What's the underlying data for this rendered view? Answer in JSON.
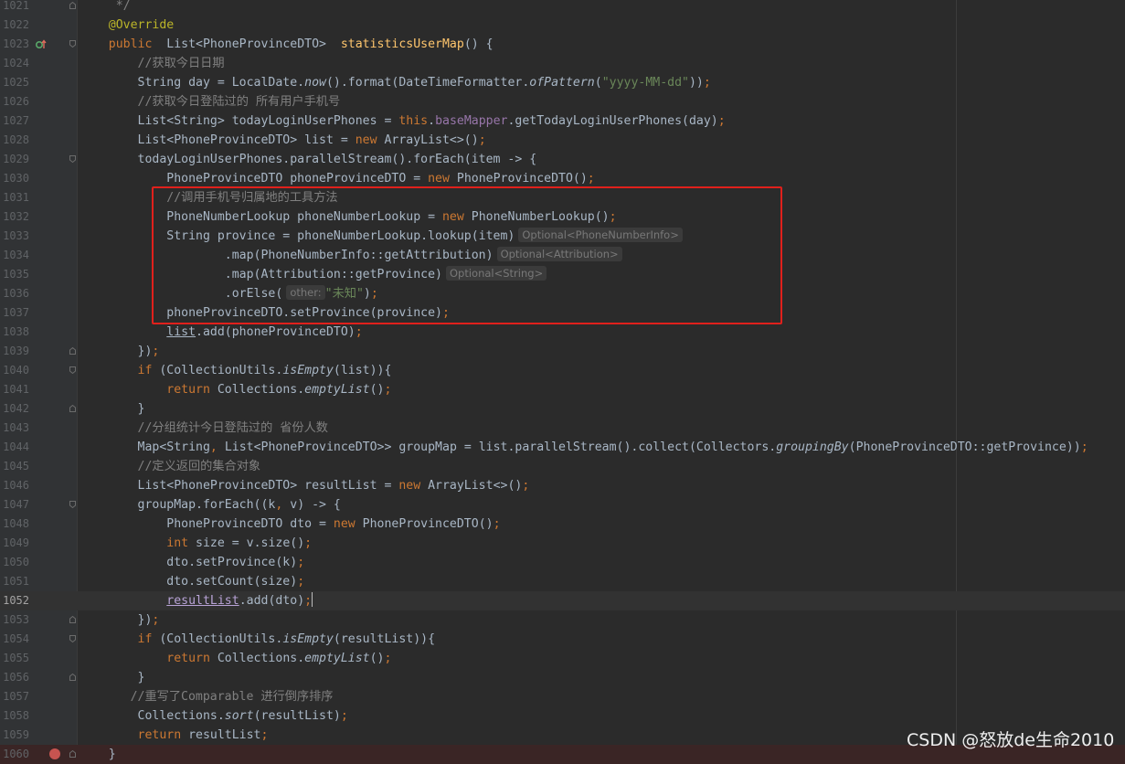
{
  "editor": {
    "language": "java",
    "lines": [
      {
        "no": "1021",
        "tokens": [
          [
            "c",
            "     */"
          ]
        ]
      },
      {
        "no": "1022",
        "tokens": [
          [
            "a",
            "    @Override"
          ]
        ]
      },
      {
        "no": "1023",
        "tokens": [
          [
            "k",
            "    public  "
          ],
          [
            "p",
            "List<PhoneProvinceDTO>  "
          ],
          [
            "m",
            "statisticsUserMap"
          ],
          [
            "p",
            "() {"
          ]
        ]
      },
      {
        "no": "1024",
        "tokens": [
          [
            "c",
            "        //获取今日日期"
          ]
        ]
      },
      {
        "no": "1025",
        "tokens": [
          [
            "p",
            "        String day = LocalDate."
          ],
          [
            "pi",
            "now"
          ],
          [
            "p",
            "().format(DateTimeFormatter."
          ],
          [
            "pi",
            "ofPattern"
          ],
          [
            "p",
            "("
          ],
          [
            "s",
            "\"yyyy-MM-dd\""
          ],
          [
            "p",
            "))"
          ],
          [
            "k",
            ";"
          ]
        ]
      },
      {
        "no": "1026",
        "tokens": [
          [
            "c",
            "        //获取今日登陆过的 所有用户手机号"
          ]
        ]
      },
      {
        "no": "1027",
        "tokens": [
          [
            "p",
            "        List<String> todayLoginUserPhones = "
          ],
          [
            "k",
            "this"
          ],
          [
            "p",
            "."
          ],
          [
            "f",
            "baseMapper"
          ],
          [
            "p",
            ".getTodayLoginUserPhones(day)"
          ],
          [
            "k",
            ";"
          ]
        ]
      },
      {
        "no": "1028",
        "tokens": [
          [
            "p",
            "        List<PhoneProvinceDTO> list = "
          ],
          [
            "k",
            "new "
          ],
          [
            "p",
            "ArrayList<>()"
          ],
          [
            "k",
            ";"
          ]
        ]
      },
      {
        "no": "1029",
        "tokens": [
          [
            "p",
            "        todayLoginUserPhones.parallelStream().forEach(item -> {"
          ]
        ]
      },
      {
        "no": "1030",
        "tokens": [
          [
            "p",
            "            PhoneProvinceDTO phoneProvinceDTO = "
          ],
          [
            "k",
            "new "
          ],
          [
            "p",
            "PhoneProvinceDTO()"
          ],
          [
            "k",
            ";"
          ]
        ]
      },
      {
        "no": "1031",
        "tokens": [
          [
            "c",
            "            //调用手机号归属地的工具方法"
          ]
        ]
      },
      {
        "no": "1032",
        "tokens": [
          [
            "p",
            "            PhoneNumberLookup phoneNumberLookup = "
          ],
          [
            "k",
            "new "
          ],
          [
            "p",
            "PhoneNumberLookup()"
          ],
          [
            "k",
            ";"
          ]
        ]
      },
      {
        "no": "1033",
        "tokens": [
          [
            "p",
            "            String province = phoneNumberLookup.lookup(item)"
          ],
          [
            "h",
            "Optional<PhoneNumberInfo>"
          ]
        ]
      },
      {
        "no": "1034",
        "tokens": [
          [
            "p",
            "                    .map(PhoneNumberInfo::getAttribution)"
          ],
          [
            "h",
            "Optional<Attribution>"
          ]
        ]
      },
      {
        "no": "1035",
        "tokens": [
          [
            "p",
            "                    .map(Attribution::getProvince)"
          ],
          [
            "h",
            "Optional<String>"
          ]
        ]
      },
      {
        "no": "1036",
        "tokens": [
          [
            "p",
            "                    .orElse("
          ],
          [
            "h",
            "other:"
          ],
          [
            "s",
            "\"未知\""
          ],
          [
            "p",
            ")"
          ],
          [
            "k",
            ";"
          ]
        ]
      },
      {
        "no": "1037",
        "tokens": [
          [
            "p",
            "            phoneProvinceDTO.setProvince(province)"
          ],
          [
            "k",
            ";"
          ]
        ]
      },
      {
        "no": "1038",
        "tokens": [
          [
            "p",
            "            "
          ],
          [
            "pu",
            "list"
          ],
          [
            "p",
            ".add(phoneProvinceDTO)"
          ],
          [
            "k",
            ";"
          ]
        ]
      },
      {
        "no": "1039",
        "tokens": [
          [
            "p",
            "        })"
          ],
          [
            "k",
            ";"
          ]
        ]
      },
      {
        "no": "1040",
        "tokens": [
          [
            "k",
            "        if "
          ],
          [
            "p",
            "(CollectionUtils."
          ],
          [
            "pi",
            "isEmpty"
          ],
          [
            "p",
            "(list)){"
          ]
        ]
      },
      {
        "no": "1041",
        "tokens": [
          [
            "k",
            "            return "
          ],
          [
            "p",
            "Collections."
          ],
          [
            "pi",
            "emptyList"
          ],
          [
            "p",
            "()"
          ],
          [
            "k",
            ";"
          ]
        ]
      },
      {
        "no": "1042",
        "tokens": [
          [
            "p",
            "        }"
          ]
        ]
      },
      {
        "no": "1043",
        "tokens": [
          [
            "c",
            "        //分组统计今日登陆过的 省份人数"
          ]
        ]
      },
      {
        "no": "1044",
        "tokens": [
          [
            "p",
            "        Map<String"
          ],
          [
            "k",
            ", "
          ],
          [
            "p",
            "List<PhoneProvinceDTO>> groupMap = list.parallelStream().collect(Collectors."
          ],
          [
            "pi",
            "groupingBy"
          ],
          [
            "p",
            "(PhoneProvinceDTO::getProvince))"
          ],
          [
            "k",
            ";"
          ]
        ]
      },
      {
        "no": "1045",
        "tokens": [
          [
            "c",
            "        //定义返回的集合对象"
          ]
        ]
      },
      {
        "no": "1046",
        "tokens": [
          [
            "p",
            "        List<PhoneProvinceDTO> resultList = "
          ],
          [
            "k",
            "new "
          ],
          [
            "p",
            "ArrayList<>()"
          ],
          [
            "k",
            ";"
          ]
        ]
      },
      {
        "no": "1047",
        "tokens": [
          [
            "p",
            "        groupMap.forEach((k"
          ],
          [
            "k",
            ", "
          ],
          [
            "p",
            "v) -> {"
          ]
        ]
      },
      {
        "no": "1048",
        "tokens": [
          [
            "p",
            "            PhoneProvinceDTO dto = "
          ],
          [
            "k",
            "new "
          ],
          [
            "p",
            "PhoneProvinceDTO()"
          ],
          [
            "k",
            ";"
          ]
        ]
      },
      {
        "no": "1049",
        "tokens": [
          [
            "k",
            "            int "
          ],
          [
            "p",
            "size = v.size()"
          ],
          [
            "k",
            ";"
          ]
        ]
      },
      {
        "no": "1050",
        "tokens": [
          [
            "p",
            "            dto.setProvince(k)"
          ],
          [
            "k",
            ";"
          ]
        ]
      },
      {
        "no": "1051",
        "tokens": [
          [
            "p",
            "            dto.setCount(size)"
          ],
          [
            "k",
            ";"
          ]
        ]
      },
      {
        "no": "1052",
        "tokens": [
          [
            "p",
            "            "
          ],
          [
            "up",
            "resultList"
          ],
          [
            "p",
            ".add(dto)"
          ],
          [
            "k",
            ";"
          ],
          [
            "cur",
            ""
          ]
        ]
      },
      {
        "no": "1053",
        "tokens": [
          [
            "p",
            "        })"
          ],
          [
            "k",
            ";"
          ]
        ]
      },
      {
        "no": "1054",
        "tokens": [
          [
            "k",
            "        if "
          ],
          [
            "p",
            "(CollectionUtils."
          ],
          [
            "pi",
            "isEmpty"
          ],
          [
            "p",
            "(resultList)){"
          ]
        ]
      },
      {
        "no": "1055",
        "tokens": [
          [
            "k",
            "            return "
          ],
          [
            "p",
            "Collections."
          ],
          [
            "pi",
            "emptyList"
          ],
          [
            "p",
            "()"
          ],
          [
            "k",
            ";"
          ]
        ]
      },
      {
        "no": "1056",
        "tokens": [
          [
            "p",
            "        }"
          ]
        ]
      },
      {
        "no": "1057",
        "tokens": [
          [
            "c",
            "       //重写了Comparable 进行倒序排序"
          ]
        ]
      },
      {
        "no": "1058",
        "tokens": [
          [
            "p",
            "        Collections."
          ],
          [
            "pi",
            "sort"
          ],
          [
            "p",
            "(resultList)"
          ],
          [
            "k",
            ";"
          ]
        ]
      },
      {
        "no": "1059",
        "tokens": [
          [
            "k",
            "        return "
          ],
          [
            "p",
            "resultList"
          ],
          [
            "k",
            ";"
          ]
        ]
      },
      {
        "no": "1060",
        "tokens": [
          [
            "p",
            "    }"
          ]
        ]
      }
    ],
    "current_line": "1052"
  },
  "colors": {
    "background": "#2b2b2b",
    "gutter": "#313335",
    "keyword": "#cc7832",
    "string": "#6a8759",
    "comment": "#808080",
    "annotation": "#bbb529",
    "method_declaration": "#ffc66d",
    "field": "#9876aa",
    "plain": "#a9b7c6",
    "highlight_box": "#e0201c"
  },
  "icons": {
    "line_1023": "override-method-icon",
    "line_1060": "breakpoint-icon",
    "fold": "fold-marker-icon"
  },
  "watermark": {
    "text": "CSDN @怒放de生命2010"
  }
}
